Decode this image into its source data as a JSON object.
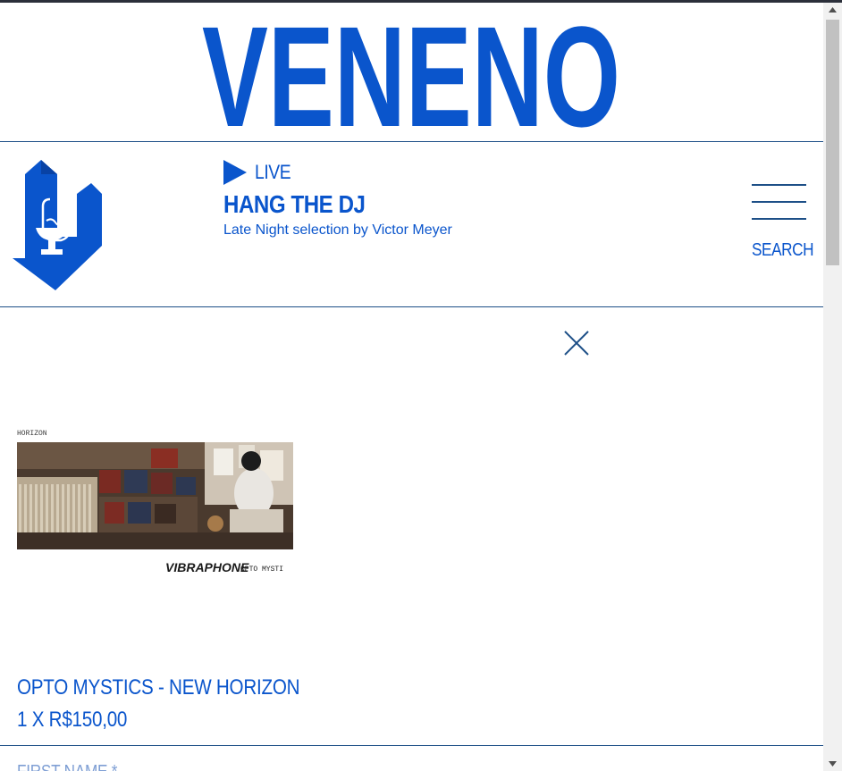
{
  "brand": {
    "wordmark": "VENENO",
    "accent_color": "#0a55cc",
    "logo_icon": "veneno-pharmacy-logo-icon"
  },
  "header": {
    "live_label": "LIVE",
    "show_title": "HANG THE DJ",
    "show_subtitle": "Late Night selection by Victor Meyer",
    "search_label": "SEARCH",
    "menu_icon": "hamburger-menu-icon",
    "play_icon": "play-icon"
  },
  "cart": {
    "close_icon": "close-icon",
    "item": {
      "cover_header_text": "HORIZON",
      "cover_label_left": "VIBRAPHONE",
      "cover_label_right": "OPTO MYSTI",
      "name": "OPTO MYSTICS - NEW HORIZON",
      "quantity_price": "1 X R$150,00"
    },
    "form": {
      "first_name_label": "FIRST NAME *"
    }
  }
}
